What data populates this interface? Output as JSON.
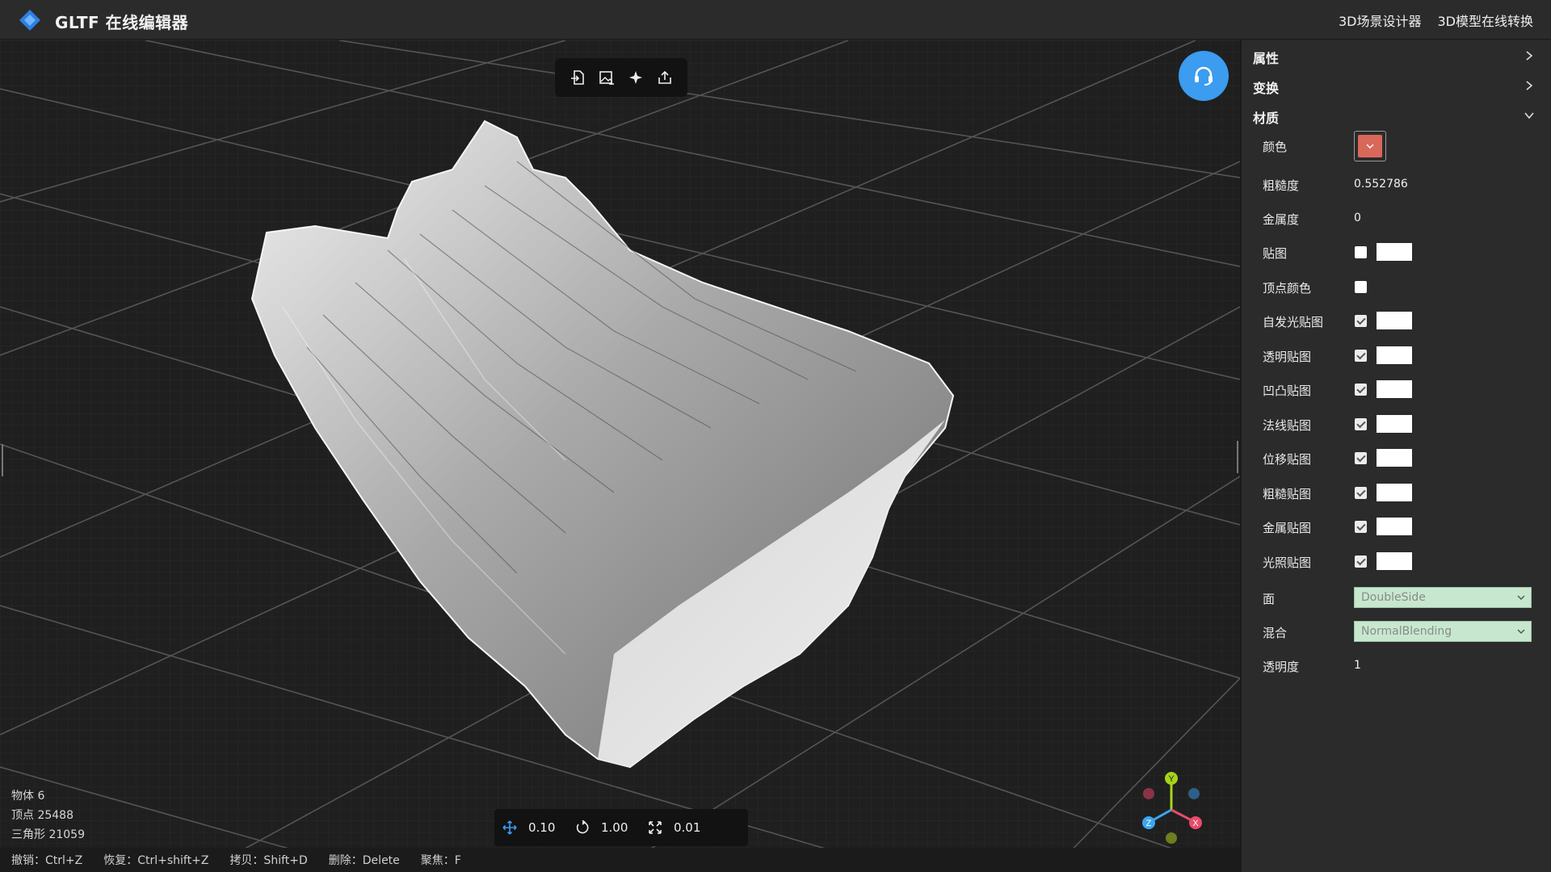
{
  "header": {
    "title": "GLTF 在线编辑器",
    "links": [
      "3D场景设计器",
      "3D模型在线转换"
    ]
  },
  "toolbar": {
    "icons": [
      "import-icon",
      "image-import-icon",
      "light-icon",
      "export-icon"
    ]
  },
  "stats": {
    "objects": "物体 6",
    "vertices": "顶点 25488",
    "triangles": "三角形 21059"
  },
  "transform": {
    "move": "0.10",
    "rotate": "1.00",
    "scale": "0.01"
  },
  "shortcuts": [
    "撤销：Ctrl+Z",
    "恢复：Ctrl+shift+Z",
    "拷贝：Shift+D",
    "删除：Delete",
    "聚焦：F"
  ],
  "panel": {
    "sections": {
      "properties": "属性",
      "transform": "变换",
      "material": "材质"
    },
    "material": {
      "color_label": "颜色",
      "color_value": "#d9675a",
      "roughness_label": "粗糙度",
      "roughness_value": "0.552786",
      "metalness_label": "金属度",
      "metalness_value": "0",
      "maps": [
        {
          "label": "贴图",
          "checked": false,
          "has_texture": true
        },
        {
          "label": "顶点颜色",
          "checked": false,
          "has_texture": false
        },
        {
          "label": "自发光贴图",
          "checked": true,
          "has_texture": true
        },
        {
          "label": "透明贴图",
          "checked": true,
          "has_texture": true
        },
        {
          "label": "凹凸贴图",
          "checked": true,
          "has_texture": true
        },
        {
          "label": "法线贴图",
          "checked": true,
          "has_texture": true
        },
        {
          "label": "位移贴图",
          "checked": true,
          "has_texture": true
        },
        {
          "label": "粗糙贴图",
          "checked": true,
          "has_texture": true
        },
        {
          "label": "金属贴图",
          "checked": true,
          "has_texture": true
        },
        {
          "label": "光照贴图",
          "checked": true,
          "has_texture": true
        }
      ],
      "side_label": "面",
      "side_value": "DoubleSide",
      "blend_label": "混合",
      "blend_value": "NormalBlending",
      "opacity_label": "透明度",
      "opacity_value": "1"
    }
  },
  "colors": {
    "accent": "#3b9cf0",
    "select_bg": "#c7e8cf",
    "axis_x": "#e94b6b",
    "axis_y": "#a6d41a",
    "axis_z": "#3aa6f0"
  }
}
